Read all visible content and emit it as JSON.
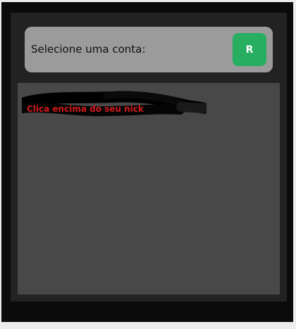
{
  "account_picker": {
    "label": "Selecione uma conta:",
    "refresh_label": "R",
    "refresh_color": "#27ae60"
  },
  "account_list": {
    "hint": "Clica encima do seu nick",
    "hint_color": "#d0191c",
    "redacted_entry_color": "#000000"
  }
}
